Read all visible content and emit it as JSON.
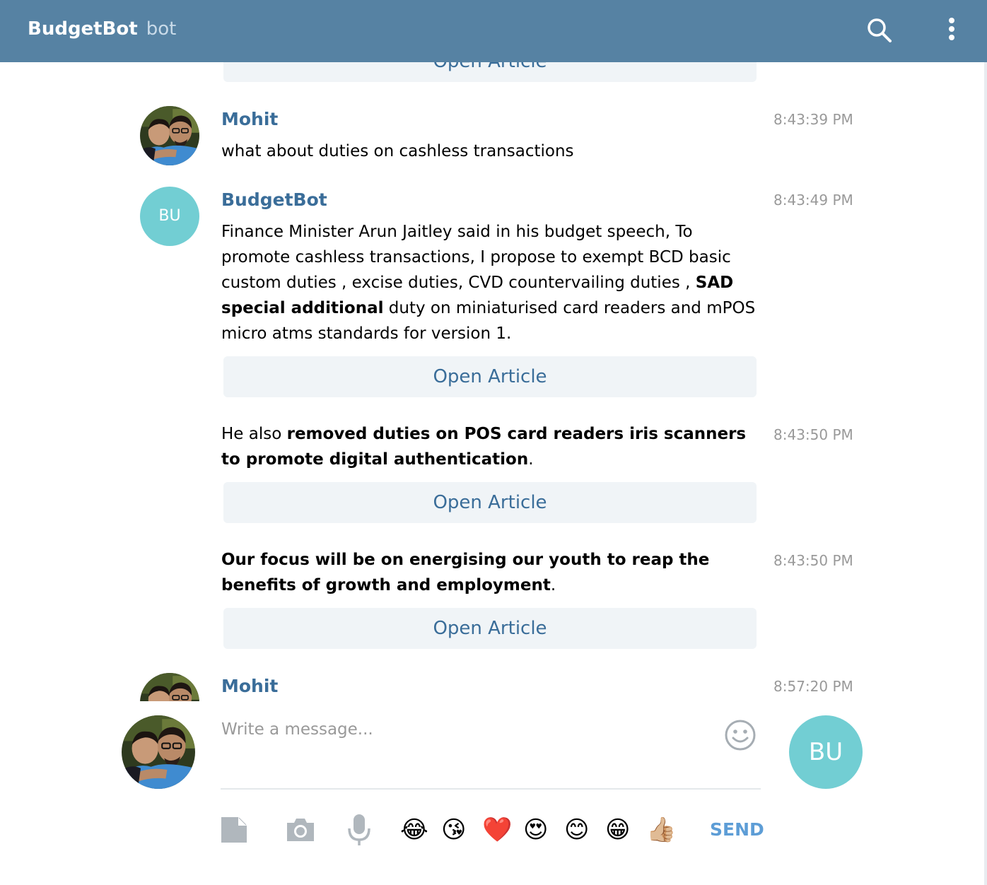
{
  "header": {
    "title": "BudgetBot",
    "subtitle": "bot",
    "search_icon": "search-icon",
    "menu_icon": "more-vertical-icon"
  },
  "history": {
    "partial_button": "Open Article",
    "messages": [
      {
        "author": "Mohit",
        "time": "8:43:39 PM",
        "text": "what about duties on cashless transactions",
        "avatar": "photo"
      },
      {
        "author": "BudgetBot",
        "avatar_initials": "BU",
        "time": "8:43:49 PM",
        "text_parts": [
          "Finance Minister Arun Jaitley said in his budget speech, To promote cashless transactions, I propose to exempt BCD basic custom duties , excise duties, CVD countervailing duties , ",
          "SAD special additional",
          " duty on miniaturised card readers and mPOS micro atms standards for version 1."
        ],
        "button": "Open Article"
      },
      {
        "time": "8:43:50 PM",
        "text_parts": [
          "He also ",
          "removed duties on POS card readers iris scanners to promote digital authentication",
          "."
        ],
        "button": "Open Article"
      },
      {
        "time": "8:43:50 PM",
        "text_parts": [
          "Our focus will be on energising our youth to reap the benefits of growth and employment",
          "."
        ],
        "button": "Open Article"
      },
      {
        "author": "Mohit",
        "time": "8:57:20 PM",
        "avatar": "photo"
      }
    ]
  },
  "composer": {
    "placeholder": "Write a message...",
    "bot_initials": "BU",
    "send_label": "SEND",
    "tools": [
      "file-icon",
      "camera-icon",
      "microphone-icon"
    ],
    "emojis": [
      "😂",
      "😘",
      "❤️",
      "😍",
      "😊",
      "😁",
      "👍🏼"
    ],
    "emoji_names": [
      "tears-of-joy",
      "blowing-kiss",
      "red-heart",
      "heart-eyes",
      "smiling",
      "grinning",
      "thumbs-up"
    ]
  },
  "colors": {
    "header_bg": "#5682a3",
    "author": "#3a6d99",
    "bot_avatar": "#72ced3",
    "button_bg": "#f0f4f7",
    "send": "#5d9dd6"
  }
}
